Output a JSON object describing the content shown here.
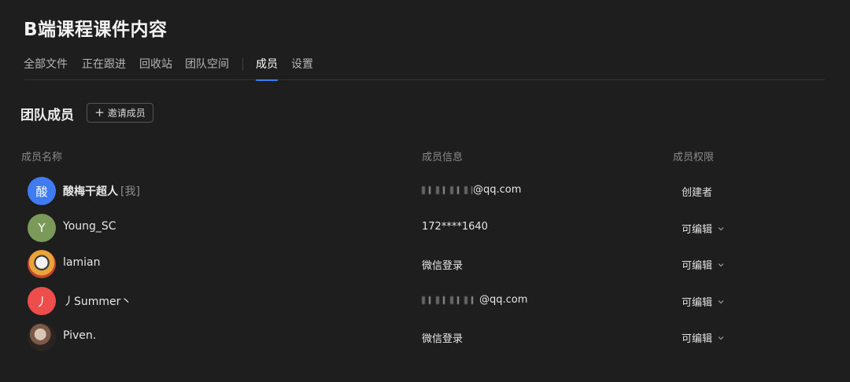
{
  "header": {
    "title": "B端课程课件内容"
  },
  "tabs": [
    {
      "label": "全部文件",
      "active": false
    },
    {
      "label": "正在跟进",
      "active": false
    },
    {
      "label": "回收站",
      "active": false
    },
    {
      "label": "团队空间",
      "active": false
    },
    {
      "label": "成员",
      "active": true
    },
    {
      "label": "设置",
      "active": false
    }
  ],
  "members_section": {
    "title": "团队成员",
    "invite_label": "邀请成员",
    "invite_icon": "plus-icon"
  },
  "columns": {
    "name": "成员名称",
    "info": "成员信息",
    "permission": "成员权限"
  },
  "members": [
    {
      "avatar_text": "酸",
      "avatar_color": "#3f7cf4",
      "name": "酸梅干超人",
      "me_tag": "[我]",
      "info_prefix": "",
      "info_suffix": "@qq.com",
      "info": "",
      "role": "创建者",
      "role_editable": false
    },
    {
      "avatar_text": "Y",
      "avatar_color": "#7b9a5a",
      "name": "Young_SC",
      "me_tag": "",
      "info": "172****1640",
      "role": "可编辑",
      "role_editable": true
    },
    {
      "avatar_text": "",
      "avatar_color": "#e9a43a",
      "name": "lamian",
      "me_tag": "",
      "info": "微信登录",
      "role": "可编辑",
      "role_editable": true
    },
    {
      "avatar_text": "丿",
      "avatar_color": "#ee4e4b",
      "name": "丿Summer丶",
      "me_tag": "",
      "info_suffix": "@qq.com",
      "info": "",
      "role": "可编辑",
      "role_editable": true
    },
    {
      "avatar_text": "",
      "avatar_color": "#5a4a40",
      "name": "Piven.",
      "me_tag": "",
      "info": "微信登录",
      "role": "可编辑",
      "role_editable": true
    }
  ],
  "colors": {
    "accent": "#3b7ff5",
    "background": "#1e1e1e"
  }
}
